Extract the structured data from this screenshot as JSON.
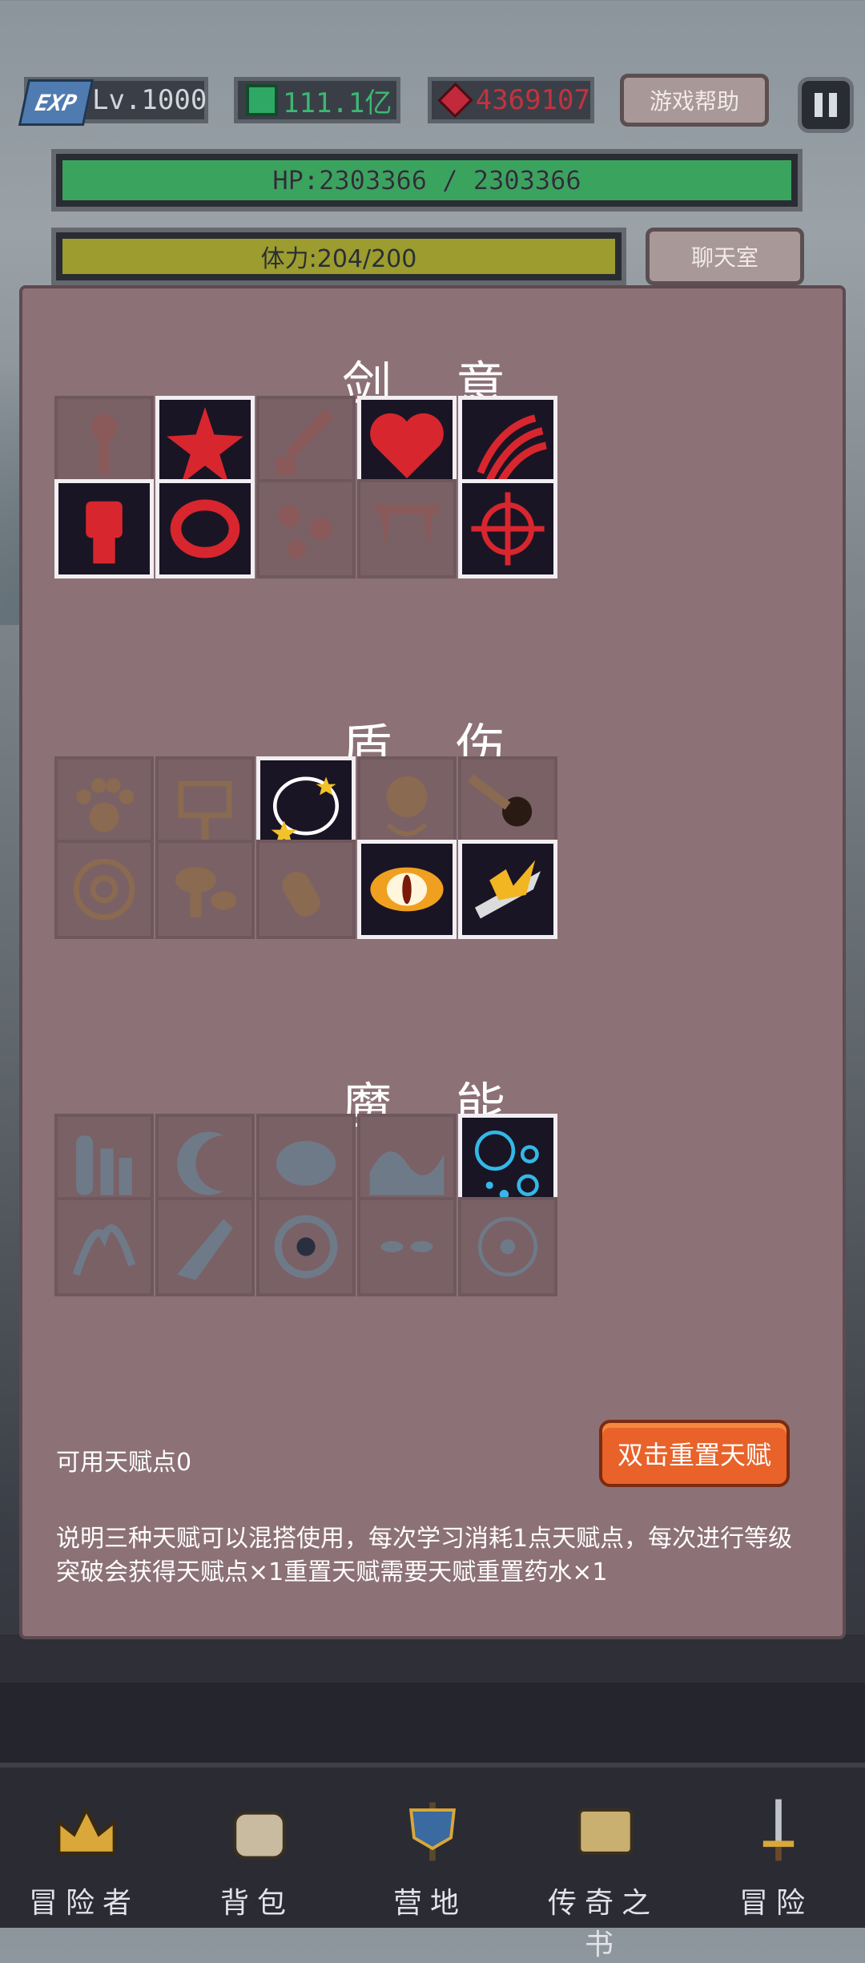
{
  "top": {
    "exp_badge": "EXP",
    "level": "Lv.1000",
    "gems": "111.1亿",
    "rubies": "4369107",
    "help_label": "游戏帮助"
  },
  "hp": {
    "text": "HP:2303366 / 2303366",
    "fraction": 1.0
  },
  "stamina": {
    "text": "体力:204/200",
    "fraction": 1.0
  },
  "chat_label": "聊天室",
  "sections": [
    {
      "title": "剑 意",
      "slots": [
        {
          "icon": "club-icon",
          "active": false
        },
        {
          "icon": "blood-star-icon",
          "active": true
        },
        {
          "icon": "dagger-icon",
          "active": false
        },
        {
          "icon": "heart-icon",
          "active": true
        },
        {
          "icon": "claw-slash-icon",
          "active": true
        },
        {
          "icon": "fist-icon",
          "active": true
        },
        {
          "icon": "blood-ring-icon",
          "active": true
        },
        {
          "icon": "blood-drops-icon",
          "active": false
        },
        {
          "icon": "fangs-icon",
          "active": false
        },
        {
          "icon": "crosshair-icon",
          "active": true
        }
      ]
    },
    {
      "title": "盾 伤",
      "slots": [
        {
          "icon": "paw-icon",
          "active": false
        },
        {
          "icon": "totem-icon",
          "active": false
        },
        {
          "icon": "star-ring-icon",
          "active": true
        },
        {
          "icon": "pendant-icon",
          "active": false
        },
        {
          "icon": "meteor-icon",
          "active": false
        },
        {
          "icon": "sigil-icon",
          "active": false
        },
        {
          "icon": "mushroom-icon",
          "active": false
        },
        {
          "icon": "bullet-icon",
          "active": false
        },
        {
          "icon": "dragon-eye-icon",
          "active": true
        },
        {
          "icon": "golden-blade-icon",
          "active": true
        }
      ]
    },
    {
      "title": "魔 能",
      "slots": [
        {
          "icon": "pillars-icon",
          "active": false
        },
        {
          "icon": "crescent-icon",
          "active": false
        },
        {
          "icon": "brain-icon",
          "active": false
        },
        {
          "icon": "wave-icon",
          "active": false
        },
        {
          "icon": "bubbles-icon",
          "active": true
        },
        {
          "icon": "splash-icon",
          "active": false
        },
        {
          "icon": "shard-icon",
          "active": false
        },
        {
          "icon": "vortex-icon",
          "active": false
        },
        {
          "icon": "eyes-icon",
          "active": false
        },
        {
          "icon": "rune-icon",
          "active": false
        }
      ]
    }
  ],
  "points_label": "可用天赋点0",
  "reset_label": "双击重置天赋",
  "description": "说明三种天赋可以混搭使用，每次学习消耗1点天赋点，每次进行等级突破会获得天赋点×1重置天赋需要天赋重置药水×1",
  "nav": [
    {
      "label": "冒险者",
      "icon": "crown-icon"
    },
    {
      "label": "背包",
      "icon": "backpack-icon"
    },
    {
      "label": "营地",
      "icon": "banner-icon"
    },
    {
      "label": "传奇之书",
      "icon": "book-icon"
    },
    {
      "label": "冒险",
      "icon": "sword-icon"
    }
  ],
  "colors": {
    "panel": "#8c7177",
    "hp": "#3aa35e",
    "stamina": "#9c9c2f",
    "reset": "#e8622a"
  }
}
